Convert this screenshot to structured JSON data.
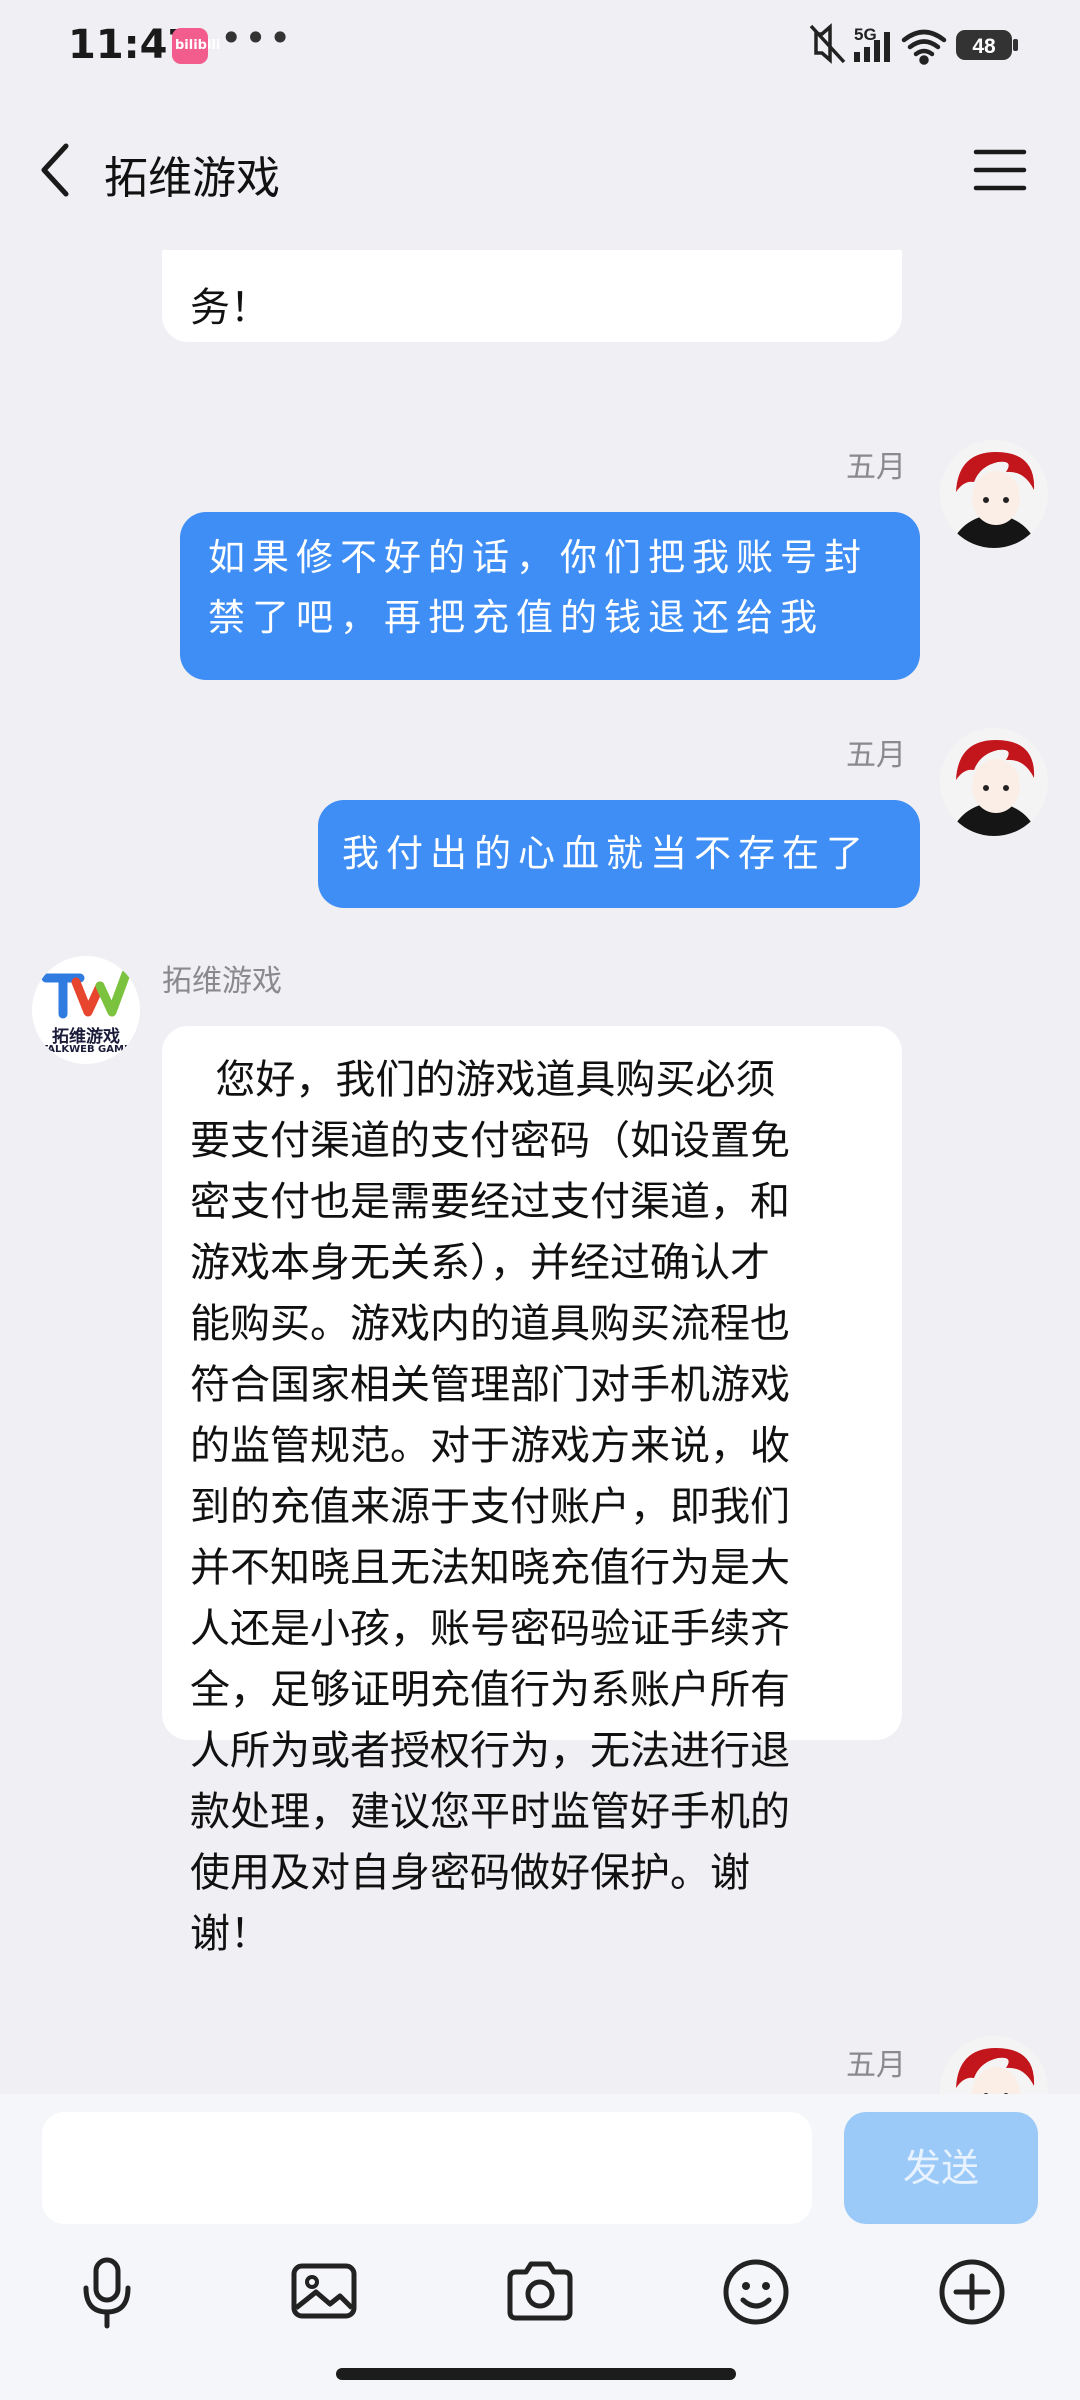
{
  "status_bar": {
    "time": "11:47",
    "app_badge": "bilibili",
    "more": "•••",
    "network": "5G",
    "battery": "48"
  },
  "header": {
    "title": "拓维游戏"
  },
  "messages": [
    {
      "type": "incoming",
      "partial": true,
      "text": "务！"
    },
    {
      "type": "outgoing",
      "time": "五月",
      "line1": "如果修不好的话，你们把我账号封",
      "line2": "禁了吧，再把充值的钱退还给我"
    },
    {
      "type": "outgoing",
      "time": "五月",
      "line1": "我付出的心血就当不存在了"
    },
    {
      "type": "incoming",
      "sender": "拓维游戏",
      "logo_text": "拓维游戏",
      "logo_subtext": "TALKWEB GAME",
      "lines": [
        "  您好，我们的游戏道具购买必须",
        "要支付渠道的支付密码（如设置免",
        "密支付也是需要经过支付渠道，和",
        "游戏本身无关系），并经过确认才",
        "能购买。游戏内的道具购买流程也",
        "符合国家相关管理部门对手机游戏",
        "的监管规范。对于游戏方来说，收",
        "到的充值来源于支付账户，即我们",
        "并不知晓且无法知晓充值行为是大",
        "人还是小孩，账号密码验证手续齐",
        "全，足够证明充值行为系账户所有",
        "人所为或者授权行为，无法进行退",
        "款处理，建议您平时监管好手机的",
        "使用及对自身密码做好保护。谢",
        "谢！"
      ]
    },
    {
      "type": "outgoing",
      "partial": true,
      "time": "五月"
    }
  ],
  "input": {
    "placeholder": "",
    "send_label": "发送"
  },
  "colors": {
    "outgoing_bubble": "#3f8ef5",
    "send_button": "#9ccaf8",
    "background": "#efeff4"
  },
  "icons": [
    "back-icon",
    "menu-icon",
    "mic-icon",
    "image-icon",
    "camera-icon",
    "emoji-icon",
    "plus-icon"
  ]
}
